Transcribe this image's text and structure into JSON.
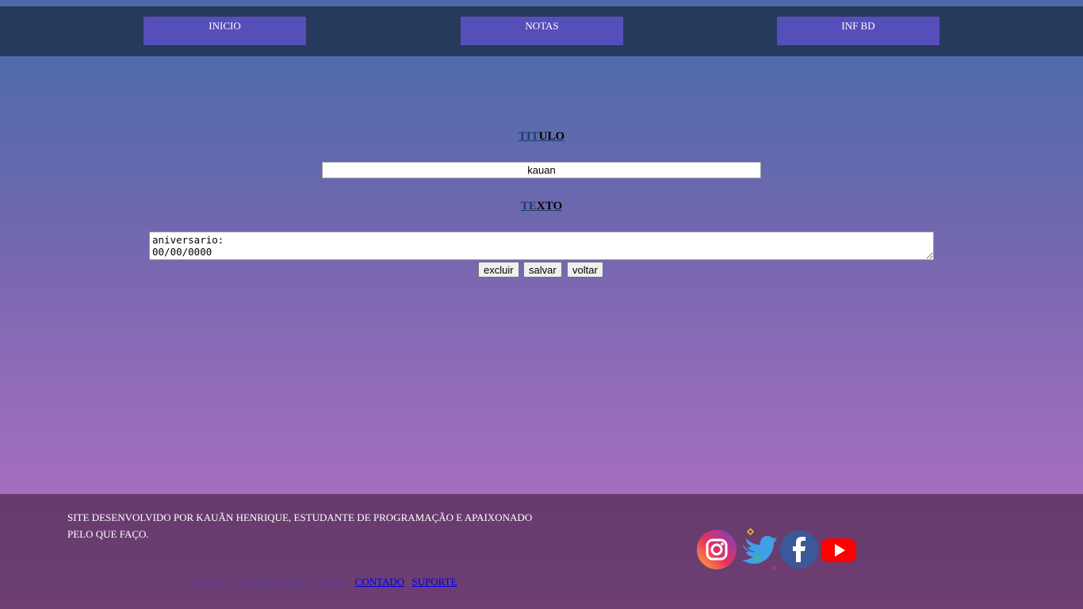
{
  "nav": {
    "items": [
      {
        "label": "INICIO"
      },
      {
        "label": "NOTAS"
      },
      {
        "label": "INF BD"
      }
    ]
  },
  "form": {
    "title_label_prefix": "TIT",
    "title_label_rest": "ULO",
    "title_value": "kauan",
    "text_label_prefix": "TE",
    "text_label_rest": "XTO",
    "text_value": "aniversario:\n00/00/0000",
    "buttons": {
      "delete": "excluir",
      "save": "salvar",
      "back": "voltar"
    }
  },
  "footer": {
    "description": "SITE DESENVOLVIDO POR KAUÃN HENRIQUE, ESTUDANTE DE PROGRAMAÇÃO E APAIXONADO PELO QUE FAÇO.",
    "links": [
      {
        "label": "INICIO"
      },
      {
        "label": "INFORMAÇÕES"
      },
      {
        "label": "NOTAS"
      },
      {
        "label": "CONTADO"
      },
      {
        "label": "SUPORTE"
      }
    ],
    "social": [
      "instagram-icon",
      "twitter-icon",
      "facebook-icon",
      "youtube-icon"
    ]
  },
  "colors": {
    "navbar": "#263a5e",
    "nav_button": "#564eb9",
    "footer": "#663c6c",
    "visited_link": "#5f3d8e",
    "unvisited_link": "#0000ee"
  }
}
